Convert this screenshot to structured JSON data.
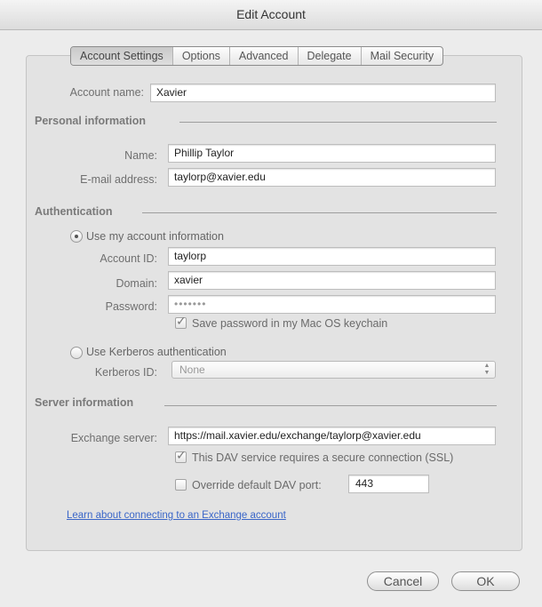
{
  "window": {
    "title": "Edit Account"
  },
  "tabs": [
    {
      "label": "Account Settings",
      "active": true
    },
    {
      "label": "Options"
    },
    {
      "label": "Advanced"
    },
    {
      "label": "Delegate"
    },
    {
      "label": "Mail Security"
    }
  ],
  "account": {
    "label": "Account name:",
    "value": "Xavier"
  },
  "personal": {
    "heading": "Personal information",
    "name_label": "Name:",
    "name_value": "Phillip Taylor",
    "email_label": "E-mail address:",
    "email_value": "taylorp@xavier.edu"
  },
  "auth": {
    "heading": "Authentication",
    "use_account_label": "Use my account information",
    "account_id_label": "Account ID:",
    "account_id_value": "taylorp",
    "domain_label": "Domain:",
    "domain_value": "xavier",
    "password_label": "Password:",
    "password_value": "•••••••",
    "save_password_label": "Save password in my Mac OS keychain",
    "kerberos_label": "Use Kerberos authentication",
    "kerberos_id_label": "Kerberos ID:",
    "kerberos_id_value": "None"
  },
  "server": {
    "heading": "Server information",
    "exchange_label": "Exchange server:",
    "exchange_value": "https://mail.xavier.edu/exchange/taylorp@xavier.edu",
    "ssl_label": "This DAV service requires a secure connection (SSL)",
    "override_label": "Override default DAV port:",
    "port_value": "443"
  },
  "link": {
    "text": "Learn about connecting to an Exchange account"
  },
  "buttons": {
    "cancel": "Cancel",
    "ok": "OK"
  }
}
